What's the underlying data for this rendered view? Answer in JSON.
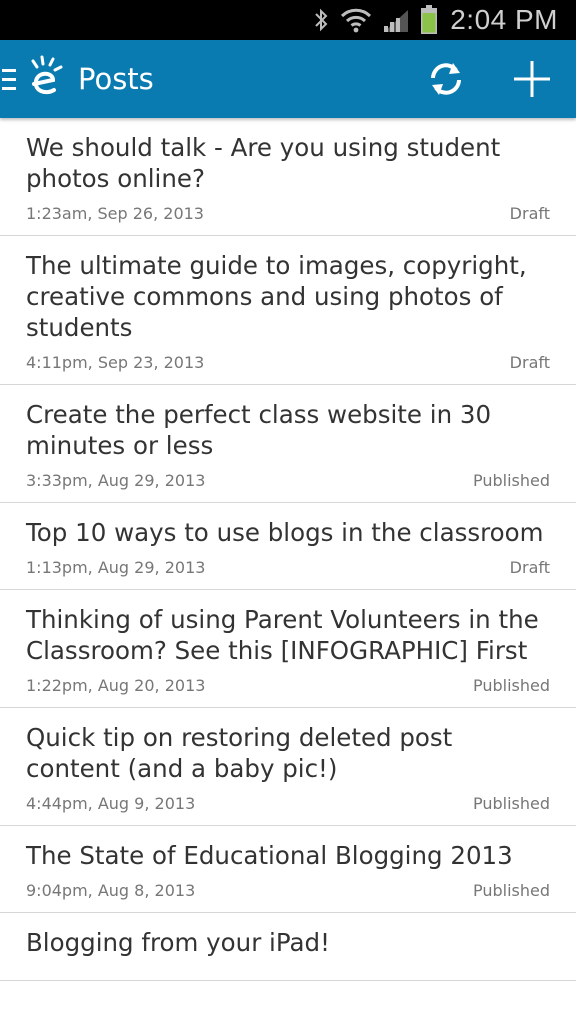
{
  "status_bar": {
    "time": "2:04 PM",
    "icons": [
      "bluetooth-icon",
      "wifi-icon",
      "signal-icon",
      "battery-icon"
    ],
    "battery_color": "#8bc34a"
  },
  "action_bar": {
    "title": "Posts",
    "background_color": "#0a7bb0",
    "icons": [
      "drawer-icon",
      "app-logo-icon",
      "refresh-icon",
      "add-icon"
    ]
  },
  "posts": [
    {
      "title": "We should talk - Are you using student photos online?",
      "date": "1:23am, Sep 26, 2013",
      "status": "Draft"
    },
    {
      "title": "The ultimate guide to images, copyright, creative commons and using photos of students",
      "date": "4:11pm, Sep 23, 2013",
      "status": "Draft"
    },
    {
      "title": "Create the perfect class website in 30 minutes or less",
      "date": "3:33pm, Aug 29, 2013",
      "status": "Published"
    },
    {
      "title": "Top 10 ways to use blogs in the classroom",
      "date": "1:13pm, Aug 29, 2013",
      "status": "Draft"
    },
    {
      "title": "Thinking of using Parent Volunteers in the Classroom? See this [INFOGRAPHIC] First",
      "date": "1:22pm, Aug 20, 2013",
      "status": "Published"
    },
    {
      "title": "Quick tip on restoring deleted post content (and a baby pic!)",
      "date": "4:44pm, Aug 9, 2013",
      "status": "Published"
    },
    {
      "title": "The State of Educational Blogging 2013",
      "date": "9:04pm, Aug 8, 2013",
      "status": "Published"
    },
    {
      "title": "Blogging from your iPad!",
      "date": "",
      "status": ""
    }
  ]
}
